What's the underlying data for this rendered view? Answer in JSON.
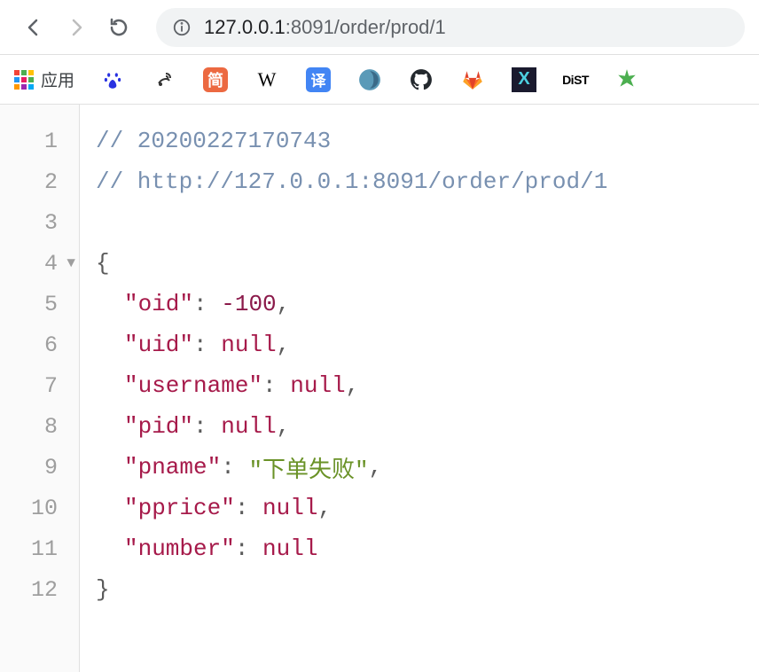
{
  "browser": {
    "url_host": "127.0.0.1",
    "url_port_path": ":8091/order/prod/1"
  },
  "bookmarks": {
    "apps_label": "应用",
    "jian": "简",
    "wiki": "W",
    "yi": "译",
    "x": "X",
    "dist": "DiST"
  },
  "code": {
    "line_numbers": [
      "1",
      "2",
      "3",
      "4",
      "5",
      "6",
      "7",
      "8",
      "9",
      "10",
      "11",
      "12"
    ],
    "comment1": "// 20200227170743",
    "comment2": "// http://127.0.0.1:8091/order/prod/1",
    "json_open": "{",
    "json_close": "}",
    "fields": {
      "oid": {
        "key": "\"oid\"",
        "value": "-100",
        "type": "number",
        "comma": ","
      },
      "uid": {
        "key": "\"uid\"",
        "value": "null",
        "type": "null",
        "comma": ","
      },
      "username": {
        "key": "\"username\"",
        "value": "null",
        "type": "null",
        "comma": ","
      },
      "pid": {
        "key": "\"pid\"",
        "value": "null",
        "type": "null",
        "comma": ","
      },
      "pname": {
        "key": "\"pname\"",
        "value": "\"下单失败\"",
        "type": "string",
        "comma": ","
      },
      "pprice": {
        "key": "\"pprice\"",
        "value": "null",
        "type": "null",
        "comma": ","
      },
      "number": {
        "key": "\"number\"",
        "value": "null",
        "type": "null",
        "comma": ""
      }
    },
    "colon": ": "
  }
}
